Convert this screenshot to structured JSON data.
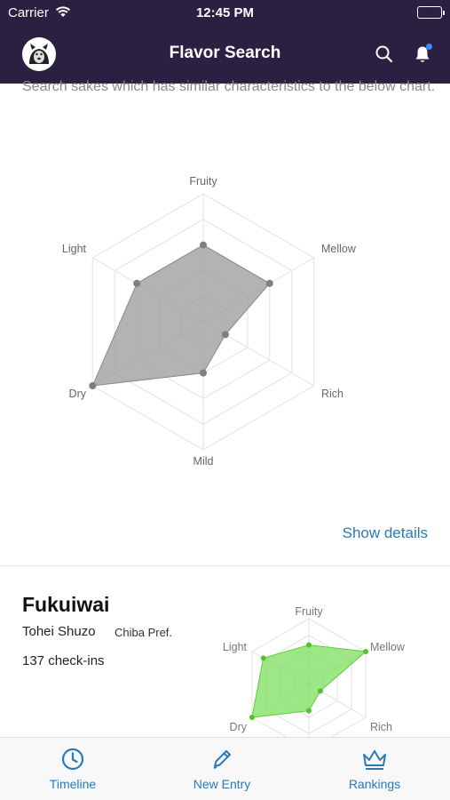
{
  "status_bar": {
    "carrier": "Carrier",
    "time": "12:45 PM"
  },
  "nav": {
    "title": "Flavor Search",
    "icons": [
      "search-icon",
      "bell-icon"
    ]
  },
  "intro_text": "Search sakes which has similar characteristics to the below chart.",
  "flavor_chart": {
    "axes": [
      "Fruity",
      "Mellow",
      "Rich",
      "Mild",
      "Dry",
      "Light"
    ],
    "values": [
      3,
      3,
      1,
      2,
      5,
      3
    ],
    "max": 5,
    "fill_color": "#9a9a9a"
  },
  "show_details": "Show details",
  "result": {
    "name": "Fukuiwai",
    "brewery": "Tohei Shuzo",
    "prefecture": "Chiba Pref.",
    "checkins": "137 check-ins",
    "chart": {
      "axes": [
        "Fruity",
        "Mellow",
        "Rich",
        "Mild",
        "Dry",
        "Light"
      ],
      "values": [
        3,
        5,
        1,
        2,
        5,
        4
      ],
      "max": 5,
      "fill_color": "#7ddf5e"
    }
  },
  "tabs": [
    {
      "label": "Timeline",
      "icon": "clock-icon"
    },
    {
      "label": "New Entry",
      "icon": "pencil-icon"
    },
    {
      "label": "Rankings",
      "icon": "crown-icon"
    }
  ],
  "colors": {
    "nav_bg": "#2c2042",
    "accent": "#2a7ab7"
  }
}
